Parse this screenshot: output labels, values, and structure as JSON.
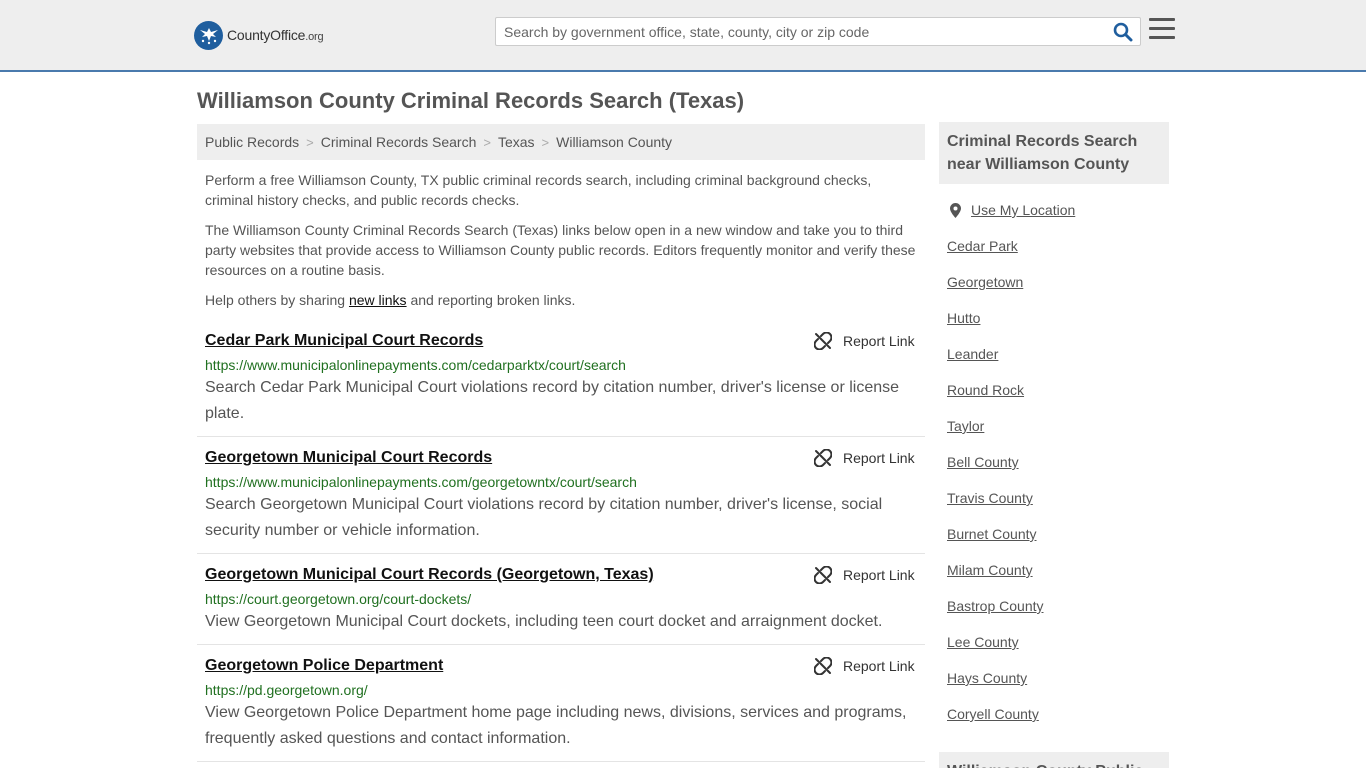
{
  "header": {
    "logo_main": "CountyOffice",
    "logo_tld": ".org",
    "search_placeholder": "Search by government office, state, county, city or zip code",
    "accent_color": "#4a7aad"
  },
  "page": {
    "title": "Williamson County Criminal Records Search (Texas)"
  },
  "breadcrumb": [
    "Public Records",
    "Criminal Records Search",
    "Texas",
    "Williamson County"
  ],
  "intro": {
    "p1": "Perform a free Williamson County, TX public criminal records search, including criminal background checks, criminal history checks, and public records checks.",
    "p2": "The Williamson County Criminal Records Search (Texas) links below open in a new window and take you to third party websites that provide access to Williamson County public records. Editors frequently monitor and verify these resources on a routine basis.",
    "p3_before": "Help others by sharing ",
    "p3_link": "new links",
    "p3_after": " and reporting broken links."
  },
  "report_label": "Report Link",
  "records": [
    {
      "title": "Cedar Park Municipal Court Records",
      "url": "https://www.municipalonlinepayments.com/cedarparktx/court/search",
      "desc": "Search Cedar Park Municipal Court violations record by citation number, driver's license or license plate."
    },
    {
      "title": "Georgetown Municipal Court Records",
      "url": "https://www.municipalonlinepayments.com/georgetowntx/court/search",
      "desc": "Search Georgetown Municipal Court violations record by citation number, driver's license, social security number or vehicle information."
    },
    {
      "title": "Georgetown Municipal Court Records (Georgetown, Texas)",
      "url": "https://court.georgetown.org/court-dockets/",
      "desc": "View Georgetown Municipal Court dockets, including teen court docket and arraignment docket."
    },
    {
      "title": "Georgetown Police Department",
      "url": "https://pd.georgetown.org/",
      "desc": "View Georgetown Police Department home page including news, divisions, services and programs, frequently asked questions and contact information."
    }
  ],
  "sidebar": {
    "heading": "Criminal Records Search near Williamson County",
    "use_location": "Use My Location",
    "items": [
      "Cedar Park",
      "Georgetown",
      "Hutto",
      "Leander",
      "Round Rock",
      "Taylor",
      "Bell County",
      "Travis County",
      "Burnet County",
      "Milam County",
      "Bastrop County",
      "Lee County",
      "Hays County",
      "Coryell County"
    ],
    "heading2": "Williamson County Public"
  }
}
